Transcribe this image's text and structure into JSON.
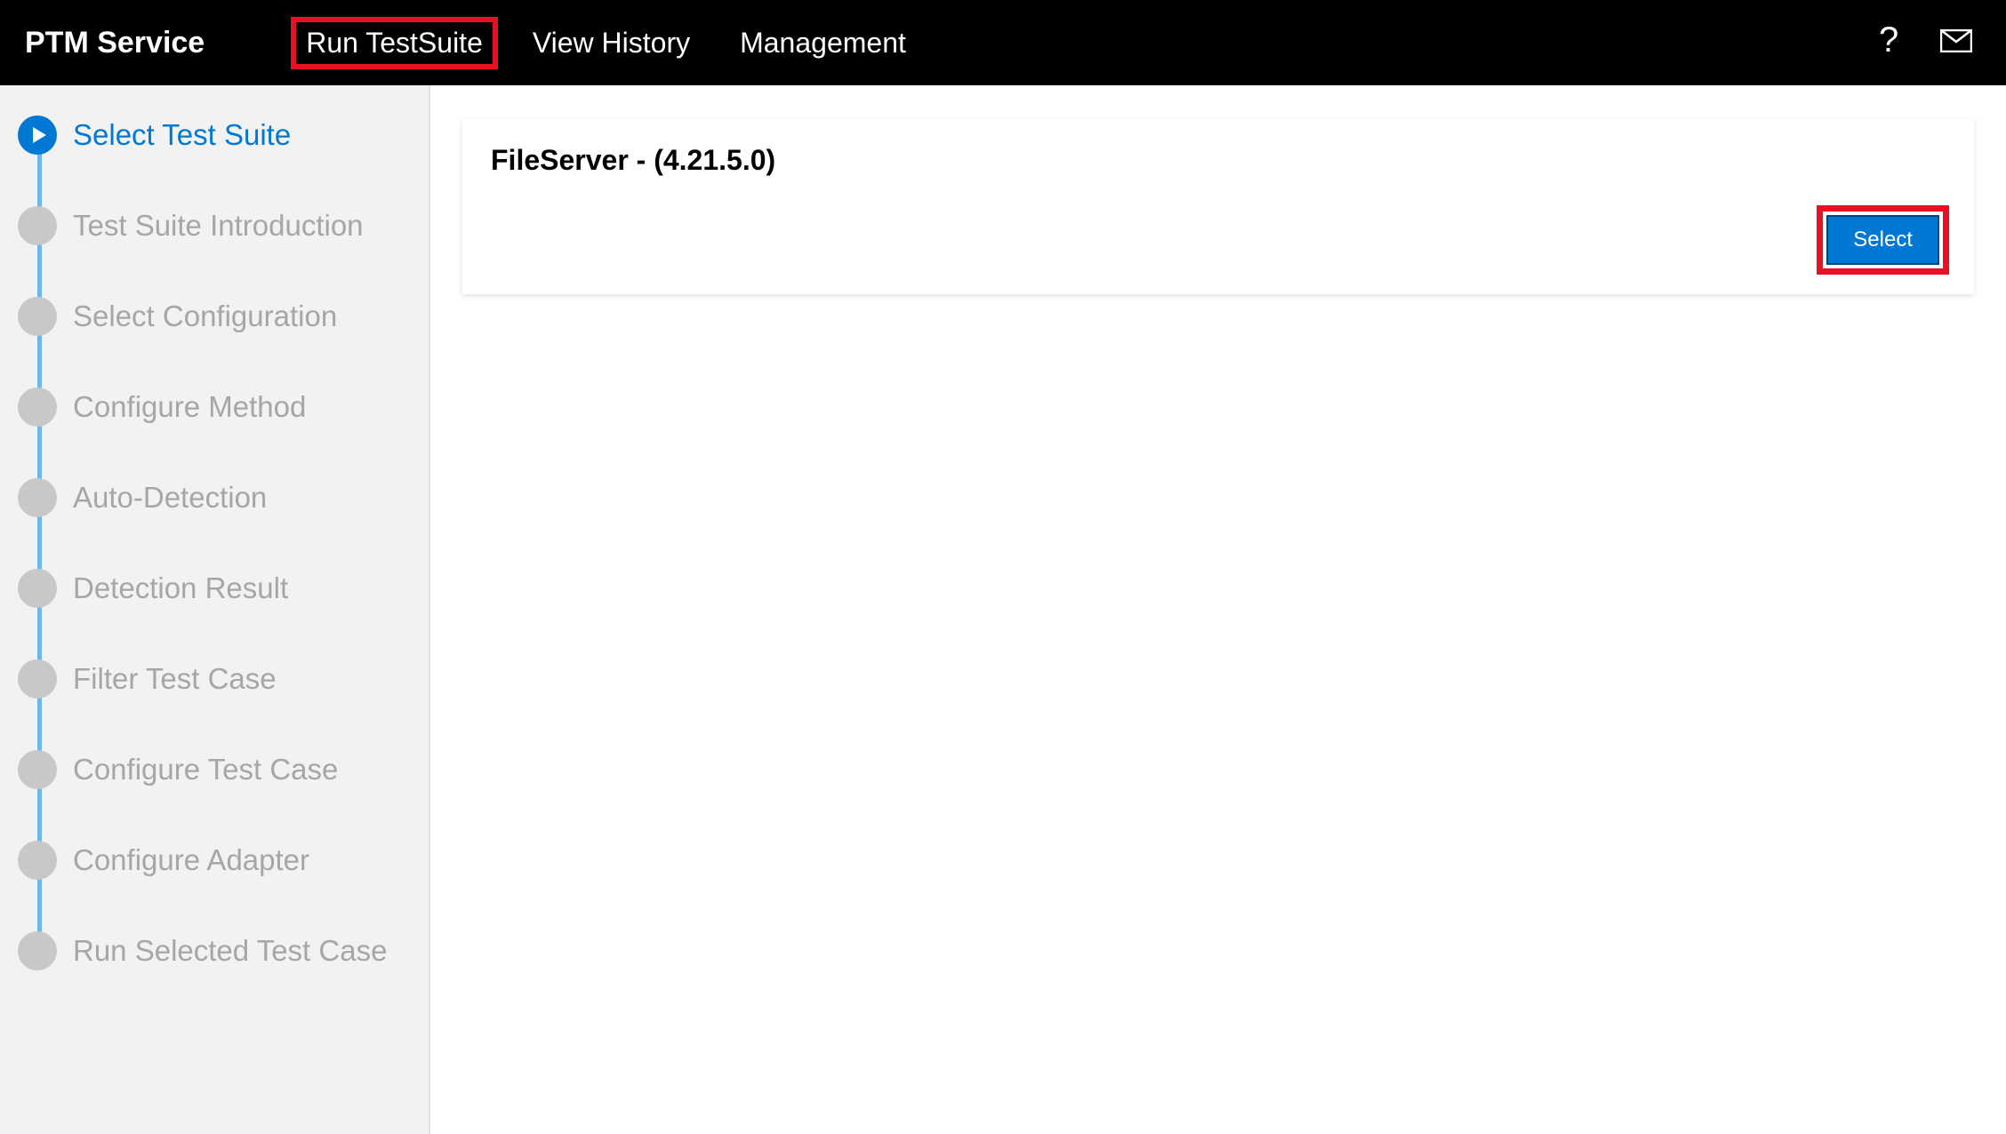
{
  "header": {
    "title": "PTM Service",
    "nav": [
      {
        "label": "Run TestSuite",
        "highlighted": true
      },
      {
        "label": "View History",
        "highlighted": false
      },
      {
        "label": "Management",
        "highlighted": false
      }
    ]
  },
  "sidebar": {
    "steps": [
      {
        "label": "Select Test Suite",
        "active": true
      },
      {
        "label": "Test Suite Introduction",
        "active": false
      },
      {
        "label": "Select Configuration",
        "active": false
      },
      {
        "label": "Configure Method",
        "active": false
      },
      {
        "label": "Auto-Detection",
        "active": false
      },
      {
        "label": "Detection Result",
        "active": false
      },
      {
        "label": "Filter Test Case",
        "active": false
      },
      {
        "label": "Configure Test Case",
        "active": false
      },
      {
        "label": "Configure Adapter",
        "active": false
      },
      {
        "label": "Run Selected Test Case",
        "active": false
      }
    ]
  },
  "content": {
    "card_title": "FileServer - (4.21.5.0)",
    "select_button": "Select"
  }
}
